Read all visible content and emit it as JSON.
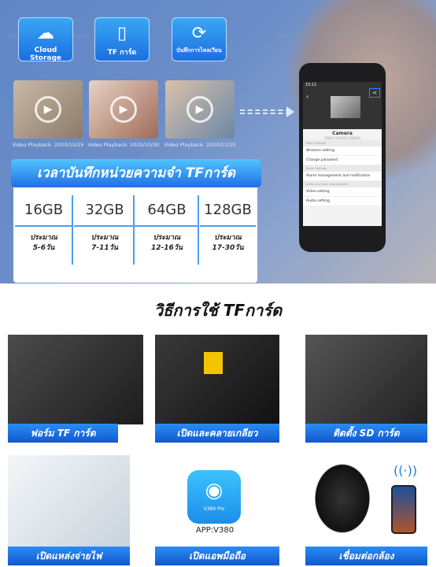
{
  "watermark": "EKCAM Official Store",
  "features": [
    {
      "label": "Cloud Storage",
      "icon": "cloud-icon"
    },
    {
      "label": "TF การ์ด",
      "icon": "sd-card-icon"
    },
    {
      "label": "บันทึกการไหลเวียน",
      "icon": "loop-record-icon"
    }
  ],
  "playbacks": [
    "Video Playback: 2020/10/25",
    "Video Playback: 2020/10/30",
    "Video Playback: 2020/11/10"
  ],
  "phone": {
    "time": "15:11",
    "camera_name": "Camera",
    "camera_id": "(SSAC-041655-ADDAD)",
    "sections": [
      {
        "title": "Basic Settings",
        "rows": [
          "Wireless setting",
          "Change password"
        ]
      },
      {
        "title": "Alarm Settings",
        "rows": [
          "Alarm management and notification"
        ]
      },
      {
        "title": "Audio and video management",
        "rows": [
          "Video setting",
          "Audio setting"
        ]
      }
    ]
  },
  "table": {
    "title": "เวลาบันทึกหน่วยความจำ TFการ์ด",
    "columns": [
      {
        "size": "16GB",
        "approx": "ประมาณ",
        "days": "5-6วัน"
      },
      {
        "size": "32GB",
        "approx": "ประมาณ",
        "days": "7-11วัน"
      },
      {
        "size": "64GB",
        "approx": "ประมาณ",
        "days": "12-16วัน"
      },
      {
        "size": "128GB",
        "approx": "ประมาณ",
        "days": "17-30วัน"
      }
    ]
  },
  "howto": {
    "title": "วิธีการใช้ TFการ์ด",
    "steps": [
      "ฟอร์ม TF การ์ด",
      "เปิดและคลายเกลียว",
      "ติดตั้ง SD การ์ด",
      "เปิดแหล่งจ่ายไฟ",
      "เปิดแอพมือถือ",
      "เชื่อมต่อกล้อง"
    ],
    "app_name": "V380 Pro",
    "app_label": "APP:V380"
  }
}
